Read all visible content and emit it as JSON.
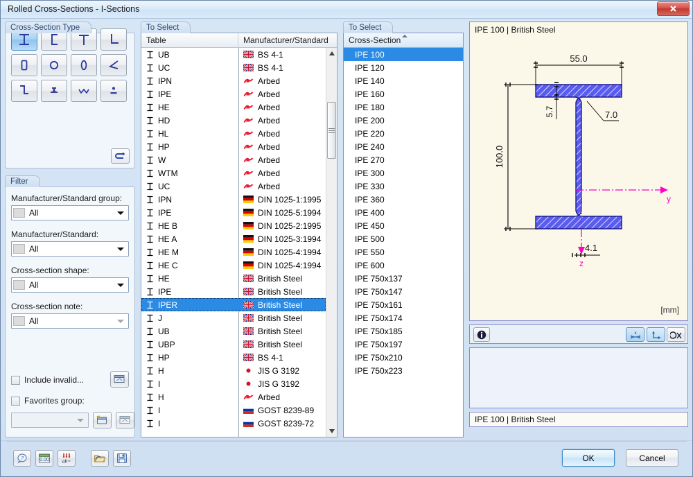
{
  "window": {
    "title": "Rolled Cross-Sections - I-Sections",
    "close_label": "x"
  },
  "cross_section_type": {
    "title": "Cross-Section Type",
    "buttons": [
      {
        "name": "i-section-icon",
        "label": "I"
      },
      {
        "name": "channel-section-icon",
        "label": "["
      },
      {
        "name": "t-section-icon",
        "label": "T"
      },
      {
        "name": "angle-section-icon",
        "label": "L"
      },
      {
        "name": "rectangular-hollow-icon",
        "label": "RHS"
      },
      {
        "name": "circular-hollow-icon",
        "label": "CHS"
      },
      {
        "name": "oval-hollow-icon",
        "label": "0"
      },
      {
        "name": "acute-angle-icon",
        "label": "angle"
      },
      {
        "name": "z-section-icon",
        "label": "Z"
      },
      {
        "name": "rail-section-icon",
        "label": "rail"
      },
      {
        "name": "corrugated-section-icon",
        "label": "w"
      },
      {
        "name": "built-up-section-icon",
        "label": "dot"
      }
    ],
    "selected_index": 0,
    "reverse_button": "reverse-icon"
  },
  "filter": {
    "title": "Filter",
    "fields": [
      {
        "label": "Manufacturer/Standard group:",
        "value": "All"
      },
      {
        "label": "Manufacturer/Standard:",
        "value": "All"
      },
      {
        "label": "Cross-section shape:",
        "value": "All"
      },
      {
        "label": "Cross-section note:",
        "value": "All"
      }
    ],
    "include_invalid_label": "Include invalid...",
    "include_invalid_checked": false,
    "favorites_label": "Favorites group:",
    "favorites_checked": false,
    "favorites_value": ""
  },
  "table_list": {
    "group_title": "To Select",
    "columns": [
      "Table",
      "Manufacturer/Standard"
    ],
    "selected_index": 19,
    "rows": [
      {
        "table": "UB",
        "standard": "BS 4-1",
        "flag": "uk"
      },
      {
        "table": "UC",
        "standard": "BS 4-1",
        "flag": "uk"
      },
      {
        "table": "IPN",
        "standard": "Arbed",
        "flag": "arbed"
      },
      {
        "table": "IPE",
        "standard": "Arbed",
        "flag": "arbed"
      },
      {
        "table": "HE",
        "standard": "Arbed",
        "flag": "arbed"
      },
      {
        "table": "HD",
        "standard": "Arbed",
        "flag": "arbed"
      },
      {
        "table": "HL",
        "standard": "Arbed",
        "flag": "arbed"
      },
      {
        "table": "HP",
        "standard": "Arbed",
        "flag": "arbed"
      },
      {
        "table": "W",
        "standard": "Arbed",
        "flag": "arbed"
      },
      {
        "table": "WTM",
        "standard": "Arbed",
        "flag": "arbed"
      },
      {
        "table": "UC",
        "standard": "Arbed",
        "flag": "arbed"
      },
      {
        "table": "IPN",
        "standard": "DIN 1025-1:1995",
        "flag": "de"
      },
      {
        "table": "IPE",
        "standard": "DIN 1025-5:1994",
        "flag": "de"
      },
      {
        "table": "HE B",
        "standard": "DIN 1025-2:1995",
        "flag": "de"
      },
      {
        "table": "HE A",
        "standard": "DIN 1025-3:1994",
        "flag": "de"
      },
      {
        "table": "HE M",
        "standard": "DIN 1025-4:1994",
        "flag": "de"
      },
      {
        "table": "HE C",
        "standard": "DIN 1025-4:1994",
        "flag": "de"
      },
      {
        "table": "HE",
        "standard": "British Steel",
        "flag": "uk"
      },
      {
        "table": "IPE",
        "standard": "British Steel",
        "flag": "uk"
      },
      {
        "table": "IPER",
        "standard": "British Steel",
        "flag": "uk"
      },
      {
        "table": "J",
        "standard": "British Steel",
        "flag": "uk"
      },
      {
        "table": "UB",
        "standard": "British Steel",
        "flag": "uk"
      },
      {
        "table": "UBP",
        "standard": "British Steel",
        "flag": "uk"
      },
      {
        "table": "HP",
        "standard": "BS 4-1",
        "flag": "uk"
      },
      {
        "table": "H",
        "standard": "JIS G 3192",
        "flag": "jp"
      },
      {
        "table": "I",
        "standard": "JIS G 3192",
        "flag": "jp"
      },
      {
        "table": "H",
        "standard": "Arbed",
        "flag": "arbed"
      },
      {
        "table": "I",
        "standard": "GOST 8239-89",
        "flag": "ru"
      },
      {
        "table": "I",
        "standard": "GOST 8239-72",
        "flag": "ru"
      }
    ]
  },
  "cross_section_list": {
    "group_title": "To Select",
    "column": "Cross-Section",
    "selected_index": 0,
    "items": [
      "IPE 100",
      "IPE 120",
      "IPE 140",
      "IPE 160",
      "IPE 180",
      "IPE 200",
      "IPE 220",
      "IPE 240",
      "IPE 270",
      "IPE 300",
      "IPE 330",
      "IPE 360",
      "IPE 400",
      "IPE 450",
      "IPE 500",
      "IPE 550",
      "IPE 600",
      "IPE 750x137",
      "IPE 750x147",
      "IPE 750x161",
      "IPE 750x174",
      "IPE 750x185",
      "IPE 750x197",
      "IPE 750x210",
      "IPE 750x223"
    ]
  },
  "preview": {
    "caption": "IPE 100 | British Steel",
    "unit": "[mm]",
    "dimensions": {
      "width": "55.0",
      "height": "100.0",
      "flange_thickness": "5.7",
      "root_radius": "7.0",
      "web_thickness": "4.1"
    },
    "axis_y": "y",
    "axis_z": "z",
    "toolbar": {
      "info": "info-icon",
      "dimensions_toggle": "dimension-lines-icon",
      "axes_toggle": "axis-system-icon",
      "hide_toggle": "hide-dimensions-icon"
    }
  },
  "status": {
    "text": "IPE 100 | British Steel"
  },
  "footer": {
    "buttons": [
      {
        "name": "help-button",
        "icon": "help-icon"
      },
      {
        "name": "units-button",
        "icon": "units-icon"
      },
      {
        "name": "parameters-button",
        "icon": "parameters-icon"
      },
      {
        "name": "open-button",
        "icon": "folder-open-icon"
      },
      {
        "name": "save-button",
        "icon": "save-icon"
      }
    ],
    "ok_label": "OK",
    "cancel_label": "Cancel"
  },
  "colors": {
    "selection": "#2a8ae4",
    "section_fill": "#4b4ef0",
    "axis": "#ff00c8",
    "drawing_bg": "#fbf7e9"
  }
}
